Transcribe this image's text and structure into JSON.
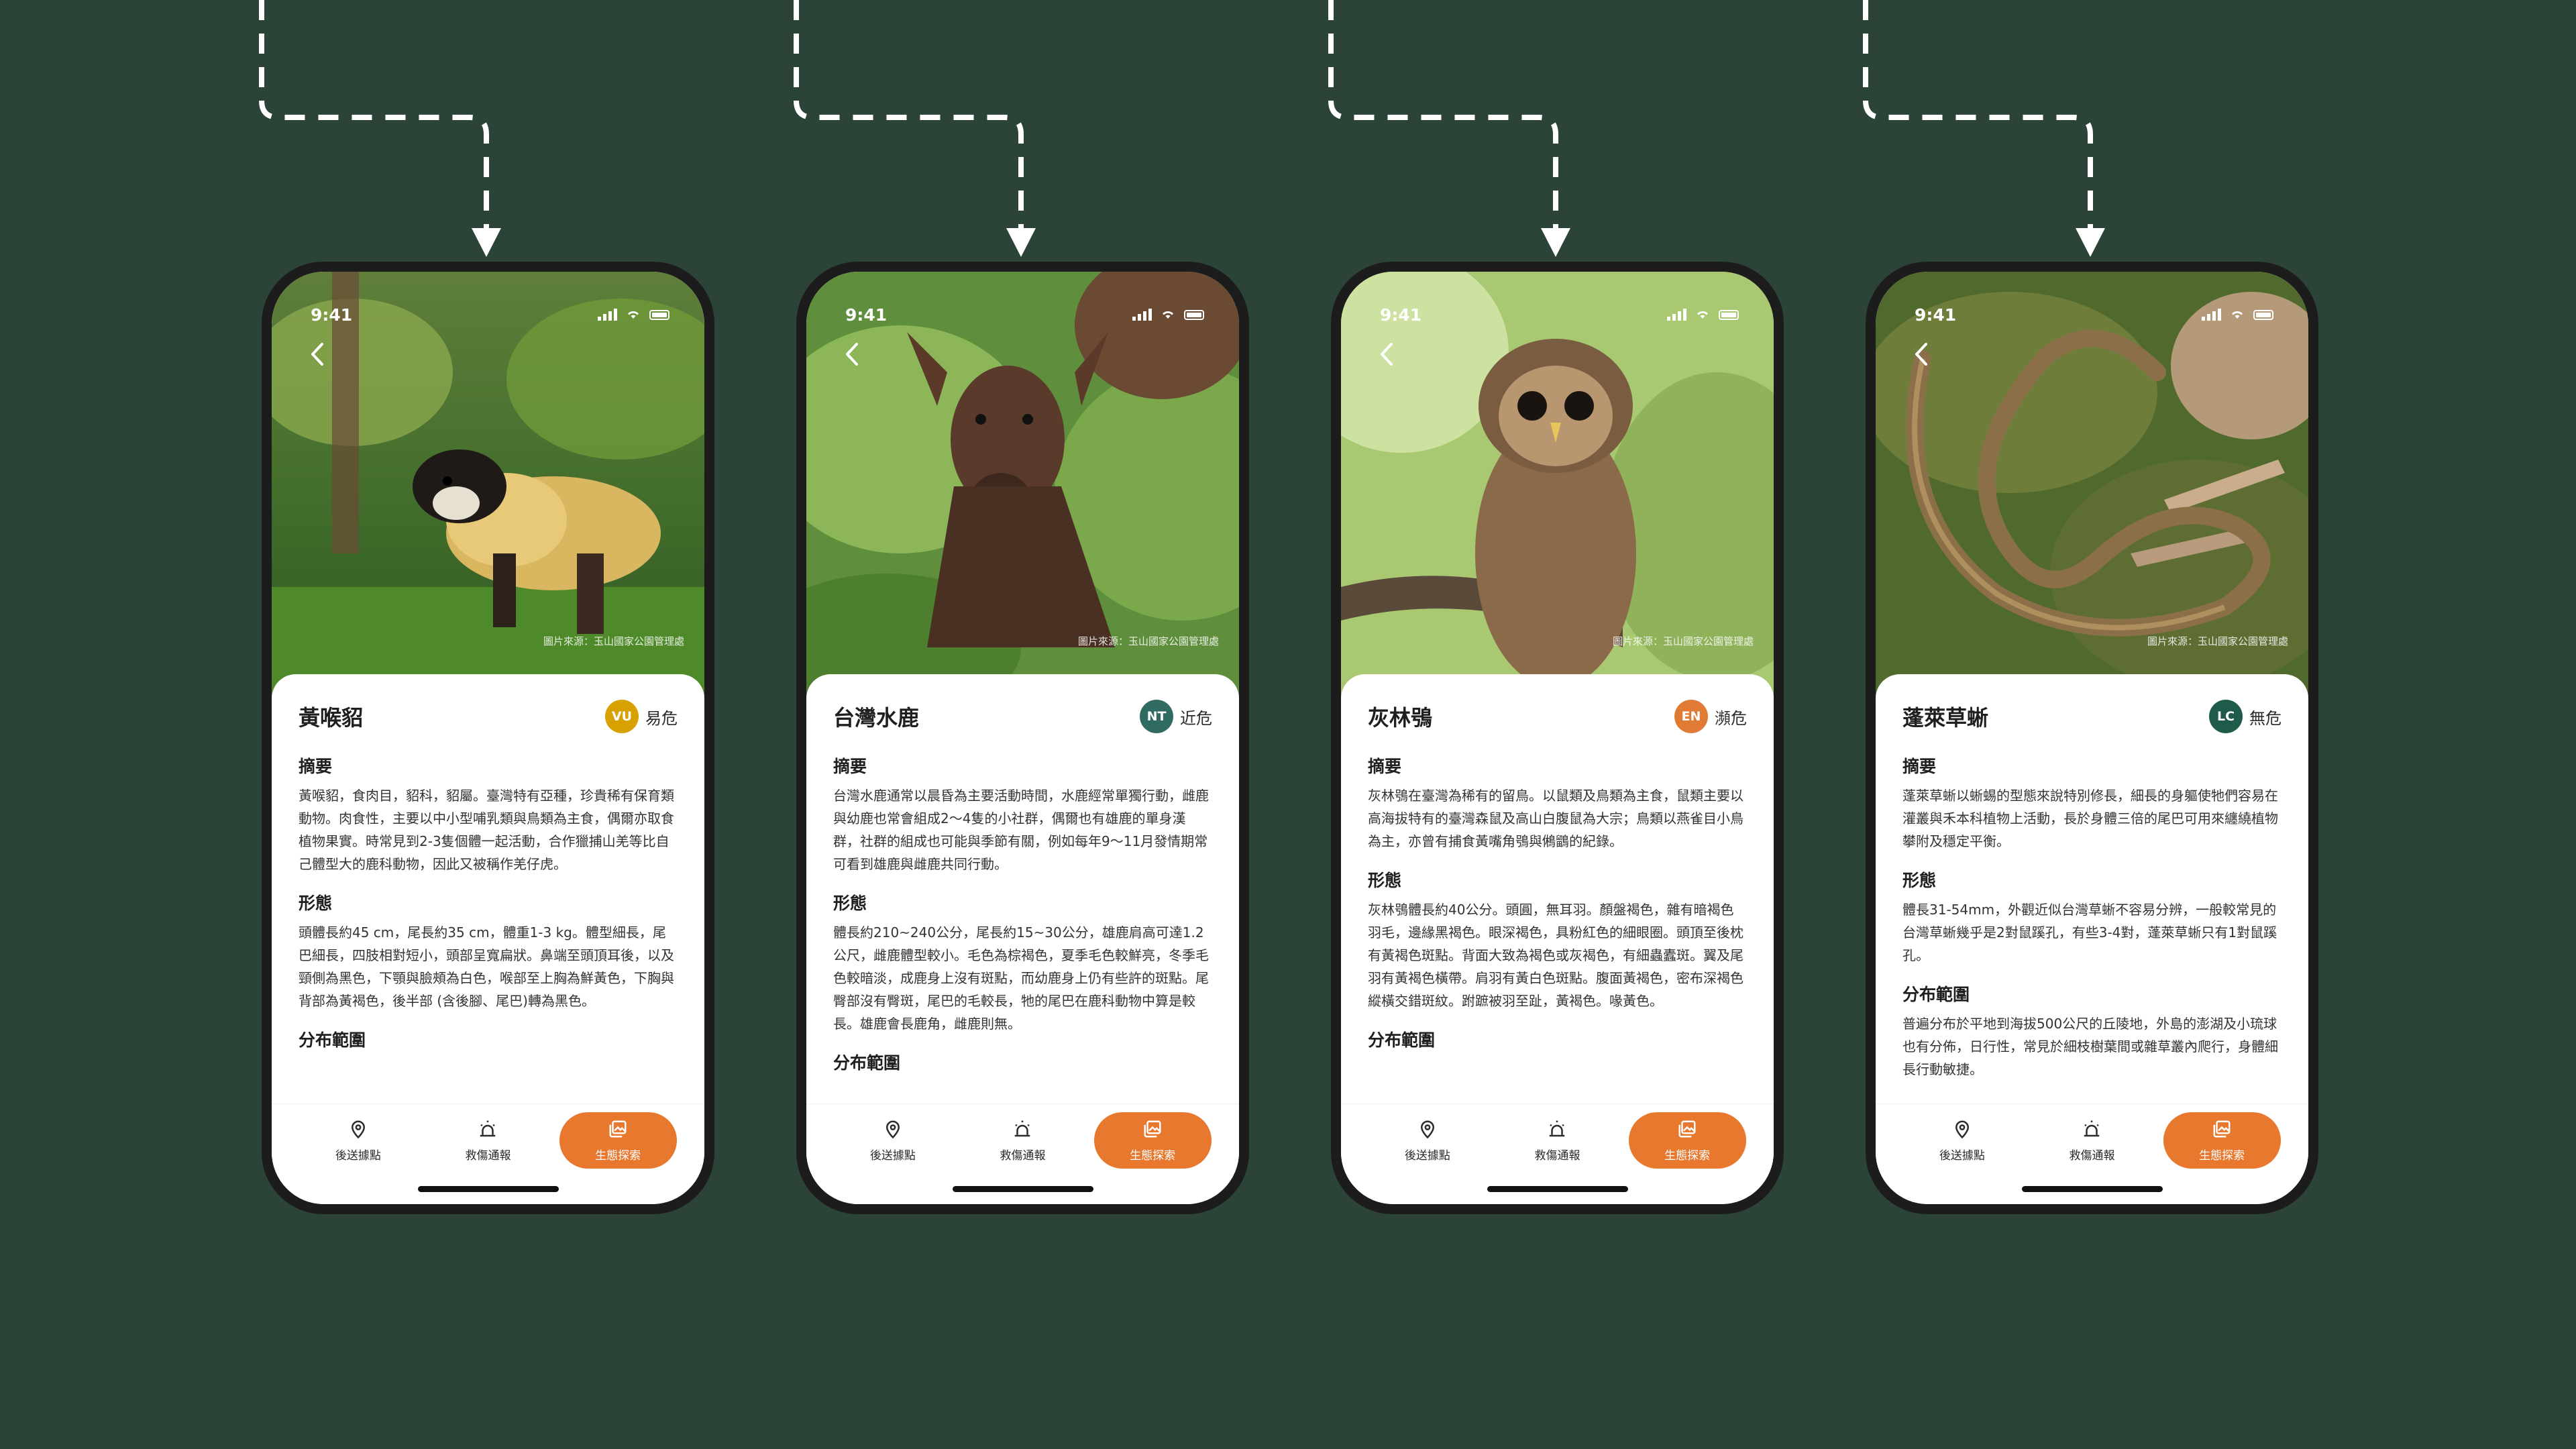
{
  "theme": {
    "background": "#2c4437",
    "accent": "#e8782e",
    "status_colors": {
      "VU": "#d7a200",
      "NT": "#2f6b60",
      "EN": "#e07b36",
      "LC": "#1f5a4a"
    }
  },
  "phones": [
    {
      "time": "9:41",
      "photo_credit": "圖片來源：玉山國家公園管理處",
      "name": "黃喉貂",
      "status_code": "VU",
      "status_label": "易危",
      "sections": [
        {
          "title": "摘要",
          "body": "黃喉貂，食肉目，貂科，貂屬。臺灣特有亞種，珍貴稀有保育類動物。肉食性，主要以中小型哺乳類與鳥類為主食，偶爾亦取食植物果實。時常見到2-3隻個體一起活動，合作獵捕山羌等比自己體型大的鹿科動物，因此又被稱作羌仔虎。"
        },
        {
          "title": "形態",
          "body": "頭體長約45 cm，尾長約35 cm，體重1-3 kg。體型細長，尾巴細長，四肢相對短小，頭部呈寬扁狀。鼻端至頭頂耳後，以及頸側為黑色，下顎與臉頰為白色，喉部至上胸為鮮黃色，下胸與背部為黃褐色，後半部 (含後腳、尾巴)轉為黑色。"
        },
        {
          "title": "分布範圍",
          "body": ""
        }
      ]
    },
    {
      "time": "9:41",
      "photo_credit": "圖片來源：玉山國家公園管理處",
      "name": "台灣水鹿",
      "status_code": "NT",
      "status_label": "近危",
      "sections": [
        {
          "title": "摘要",
          "body": "台灣水鹿通常以晨昏為主要活動時間，水鹿經常單獨行動，雌鹿與幼鹿也常會組成2～4隻的小社群，偶爾也有雄鹿的單身漢群，社群的組成也可能與季節有關，例如每年9～11月發情期常可看到雄鹿與雌鹿共同行動。"
        },
        {
          "title": "形態",
          "body": "體長約210~240公分，尾長約15~30公分，雄鹿肩高可達1.2公尺，雌鹿體型較小。毛色為棕褐色，夏季毛色較鮮亮，冬季毛色較暗淡，成鹿身上沒有斑點，而幼鹿身上仍有些許的斑點。尾臀部沒有臀斑，尾巴的毛較長，牠的尾巴在鹿科動物中算是較長。雄鹿會長鹿角，雌鹿則無。"
        },
        {
          "title": "分布範圍",
          "body": ""
        }
      ]
    },
    {
      "time": "9:41",
      "photo_credit": "圖片來源：玉山國家公園管理處",
      "name": "灰林鴞",
      "status_code": "EN",
      "status_label": "瀕危",
      "sections": [
        {
          "title": "摘要",
          "body": "灰林鴞在臺灣為稀有的留鳥。以鼠類及鳥類為主食，鼠類主要以高海拔特有的臺灣森鼠及高山白腹鼠為大宗；鳥類以燕雀目小鳥為主，亦曾有捕食黃嘴角鴞與鵂鶹的紀錄。"
        },
        {
          "title": "形態",
          "body": "灰林鴞體長約40公分。頭圓，無耳羽。顏盤褐色，雜有暗褐色羽毛，邊緣黑褐色。眼深褐色，具粉紅色的細眼圈。頭頂至後枕有黃褐色斑點。背面大致為褐色或灰褐色，有細蟲蠹斑。翼及尾羽有黃褐色橫帶。肩羽有黃白色斑點。腹面黃褐色，密布深褐色縱橫交錯斑紋。跗蹠被羽至趾，黃褐色。喙黃色。"
        },
        {
          "title": "分布範圍",
          "body": ""
        }
      ]
    },
    {
      "time": "9:41",
      "photo_credit": "圖片來源：玉山國家公園管理處",
      "name": "蓬萊草蜥",
      "status_code": "LC",
      "status_label": "無危",
      "sections": [
        {
          "title": "摘要",
          "body": "蓬萊草蜥以蜥蜴的型態來說特別修長，細長的身軀使牠們容易在灌叢與禾本科植物上活動，長於身體三倍的尾巴可用來纏繞植物攀附及穩定平衡。"
        },
        {
          "title": "形態",
          "body": "體長31-54mm，外觀近似台灣草蜥不容易分辨，一般較常見的台灣草蜥幾乎是2對鼠蹊孔，有些3-4對，蓬萊草蜥只有1對鼠蹊孔。"
        },
        {
          "title": "分布範圍",
          "body": "普遍分布於平地到海拔500公尺的丘陵地，外島的澎湖及小琉球也有分佈，日行性，常見於細枝樹葉間或雜草叢內爬行，身體細長行動敏捷。"
        }
      ]
    }
  ],
  "tabs": [
    {
      "label": "後送據點",
      "icon": "location-pin-icon"
    },
    {
      "label": "救傷通報",
      "icon": "alert-siren-icon"
    },
    {
      "label": "生態探索",
      "icon": "gallery-icon"
    }
  ]
}
